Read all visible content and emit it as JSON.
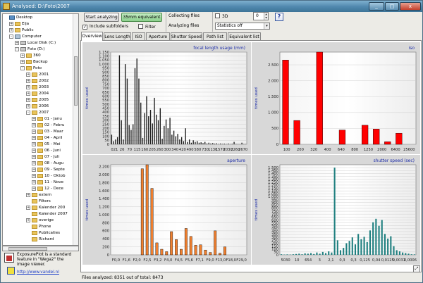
{
  "window": {
    "title": "Analysed: D:\\Foto\\2007",
    "min": "_",
    "max": "□",
    "close": "x"
  },
  "toolbar": {
    "start": "Start analyzing",
    "equiv": "35mm equivalent",
    "include_subfolders": "Include subfolders",
    "filter": "Filter",
    "collecting": "Collecting files",
    "analyzing": "Analyzing files",
    "three_d": "3D",
    "spin_value": "0",
    "statistics": "Statistics off",
    "help": "?"
  },
  "tabs": [
    "Overview",
    "Lens Length",
    "ISO",
    "Aperture",
    "Shutter Speed",
    "Path list",
    "Equivalent list"
  ],
  "tree": [
    {
      "label": "Desktop",
      "icon": "desk",
      "level": 0,
      "pm": ""
    },
    {
      "label": "Elja",
      "icon": "folder",
      "level": 1,
      "pm": "+"
    },
    {
      "label": "Public",
      "icon": "folder",
      "level": 1,
      "pm": "+"
    },
    {
      "label": "Computer",
      "icon": "comp",
      "level": 1,
      "pm": "-"
    },
    {
      "label": "Local Disk (C:)",
      "icon": "disk",
      "level": 2,
      "pm": "+"
    },
    {
      "label": "Foto (D:)",
      "icon": "disk",
      "level": 2,
      "pm": "-"
    },
    {
      "label": "360",
      "icon": "folder",
      "level": 3,
      "pm": "+"
    },
    {
      "label": "Backup",
      "icon": "folder",
      "level": 3,
      "pm": "+"
    },
    {
      "label": "Foto",
      "icon": "folder",
      "level": 3,
      "pm": "-"
    },
    {
      "label": "2001",
      "icon": "folder",
      "level": 4,
      "pm": "+"
    },
    {
      "label": "2002",
      "icon": "folder",
      "level": 4,
      "pm": "+"
    },
    {
      "label": "2003",
      "icon": "folder",
      "level": 4,
      "pm": "+"
    },
    {
      "label": "2004",
      "icon": "folder",
      "level": 4,
      "pm": "+"
    },
    {
      "label": "2005",
      "icon": "folder",
      "level": 4,
      "pm": "+"
    },
    {
      "label": "2006",
      "icon": "folder",
      "level": 4,
      "pm": "+"
    },
    {
      "label": "2007",
      "icon": "folder",
      "level": 4,
      "pm": "-"
    },
    {
      "label": "01 - Janu",
      "icon": "folder",
      "level": 5,
      "pm": "+"
    },
    {
      "label": "02 - Febru",
      "icon": "folder",
      "level": 5,
      "pm": "+"
    },
    {
      "label": "03 - Maar",
      "icon": "folder",
      "level": 5,
      "pm": "+"
    },
    {
      "label": "04 - April",
      "icon": "folder",
      "level": 5,
      "pm": "+"
    },
    {
      "label": "05 - Mei",
      "icon": "folder",
      "level": 5,
      "pm": "+"
    },
    {
      "label": "06 - Juni",
      "icon": "folder",
      "level": 5,
      "pm": "+"
    },
    {
      "label": "07 - Juli",
      "icon": "folder",
      "level": 5,
      "pm": "+"
    },
    {
      "label": "08 - Augu",
      "icon": "folder",
      "level": 5,
      "pm": "+"
    },
    {
      "label": "09 - Septe",
      "icon": "folder",
      "level": 5,
      "pm": "+"
    },
    {
      "label": "10 - Oktob",
      "icon": "folder",
      "level": 5,
      "pm": "+"
    },
    {
      "label": "11 - Nove",
      "icon": "folder",
      "level": 5,
      "pm": "+"
    },
    {
      "label": "12 - Dece",
      "icon": "folder",
      "level": 5,
      "pm": "+"
    },
    {
      "label": "extern",
      "icon": "folder",
      "level": 4,
      "pm": "+"
    },
    {
      "label": "Filters",
      "icon": "folder",
      "level": 4,
      "pm": ""
    },
    {
      "label": "Kalender 200",
      "icon": "folder",
      "level": 4,
      "pm": "+"
    },
    {
      "label": "Kalender 2007",
      "icon": "folder",
      "level": 4,
      "pm": ""
    },
    {
      "label": "overige",
      "icon": "folder",
      "level": 4,
      "pm": "+"
    },
    {
      "label": "Phone",
      "icon": "folder",
      "level": 4,
      "pm": ""
    },
    {
      "label": "Publicaties",
      "icon": "folder",
      "level": 4,
      "pm": ""
    },
    {
      "label": "Richard",
      "icon": "folder",
      "level": 4,
      "pm": ""
    }
  ],
  "info": {
    "text": "ExposurePlot is a standard feature in \"Wega2\" the image viewer.",
    "link": "http://www.vandel.nl"
  },
  "status": "Files analyzed: 8351 out of total: 8473",
  "colors": {
    "focal": "#202020",
    "iso": "#ff0000",
    "aperture": "#f08030",
    "shutter": "#208080"
  },
  "chart_data": [
    {
      "type": "bar",
      "title": "focal length usage (mm)",
      "ylabel": "times used",
      "ylim": [
        0,
        1150
      ],
      "yticks": [
        0,
        50,
        100,
        150,
        200,
        250,
        300,
        350,
        400,
        450,
        500,
        550,
        600,
        650,
        700,
        750,
        800,
        850,
        900,
        950,
        "1.000",
        "1.050",
        "1.100",
        "1.150"
      ],
      "xticks": [
        "021",
        "26",
        "70",
        "115",
        "160",
        "205",
        "260",
        "300",
        "340",
        "420",
        "490",
        "580",
        "730",
        "1130",
        "1570",
        "2030",
        "2260",
        "2670"
      ],
      "values": [
        120,
        40,
        60,
        90,
        1110,
        300,
        60,
        1000,
        820,
        240,
        180,
        250,
        950,
        1070,
        820,
        520,
        80,
        390,
        600,
        350,
        430,
        260,
        580,
        370,
        300,
        450,
        70,
        230,
        310,
        200,
        330,
        120,
        170,
        100,
        130,
        60,
        90,
        40,
        200,
        30,
        60,
        20,
        50,
        30,
        40,
        20,
        25,
        15,
        30,
        10,
        20,
        10,
        15,
        8,
        12,
        5,
        10,
        5,
        8,
        4,
        10,
        3,
        6,
        30,
        5,
        4,
        3,
        20,
        4,
        3
      ]
    },
    {
      "type": "bar",
      "title": "iso",
      "ylabel": "times used",
      "ylim": [
        0,
        2900
      ],
      "yticks": [
        0,
        500,
        "1.000",
        "1.500",
        "2.000",
        "2.500"
      ],
      "xticks": [
        "100",
        "200",
        "320",
        "400",
        "640",
        "800",
        "1250",
        "2000",
        "6400",
        "25600"
      ],
      "values": [
        2650,
        750,
        0,
        2900,
        0,
        450,
        0,
        600,
        480,
        80,
        350,
        0
      ]
    },
    {
      "type": "bar",
      "title": "aperture",
      "ylabel": "times used",
      "ylim": [
        0,
        2250
      ],
      "yticks": [
        0,
        200,
        400,
        600,
        800,
        "1.000",
        "1.200",
        "1.400",
        "1.600",
        "1.800",
        "2.000",
        "2.200"
      ],
      "xticks": [
        "F0,0",
        "F1,6",
        "F2,0",
        "F2,5",
        "F3,2",
        "F4,0",
        "F4,5",
        "F5,6",
        "F7,1",
        "F9,0",
        "F13,0",
        "F18,0",
        "F29,0"
      ],
      "values": [
        0,
        0,
        0,
        0,
        0,
        0,
        2150,
        2250,
        1660,
        300,
        140,
        80,
        580,
        380,
        140,
        660,
        460,
        240,
        250,
        120,
        60,
        600,
        40,
        200,
        0,
        0,
        0,
        0
      ]
    },
    {
      "type": "bar",
      "title": "shutter speed (sec)",
      "ylabel": "times used",
      "ylim": [
        0,
        1550
      ],
      "yticks": [
        0,
        50,
        100,
        150,
        200,
        250,
        300,
        350,
        400,
        450,
        500,
        550,
        600,
        650,
        700,
        750,
        800,
        850,
        900,
        950,
        "1.000",
        "1.050",
        "1.100",
        "1.150",
        "1.200",
        "1.250",
        "1.300",
        "1.350",
        "1.400",
        "1.450",
        "1.500"
      ],
      "xticks": [
        "5030",
        "10",
        "654",
        "3",
        "2,1",
        "0,3",
        "0,3",
        "0,125",
        "0,04",
        "0,0125",
        "0,0031",
        "0,0006"
      ],
      "values": [
        10,
        5,
        8,
        5,
        10,
        15,
        20,
        10,
        25,
        20,
        30,
        15,
        40,
        20,
        50,
        30,
        60,
        40,
        1500,
        250,
        80,
        120,
        200,
        240,
        300,
        180,
        360,
        270,
        310,
        220,
        420,
        560,
        620,
        500,
        600,
        360,
        280,
        320,
        150,
        80,
        60,
        40,
        30,
        20,
        10,
        8
      ]
    }
  ]
}
